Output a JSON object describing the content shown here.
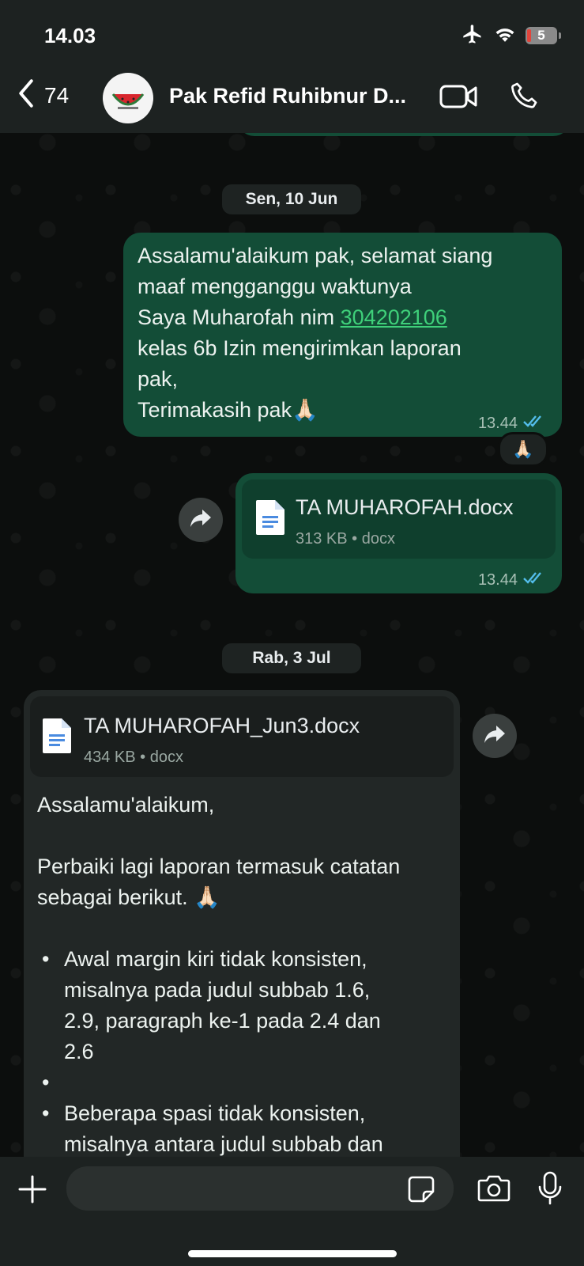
{
  "status_bar": {
    "time": "14.03",
    "battery": "5"
  },
  "header": {
    "back_count": "74",
    "contact_name": "Pak Refid Ruhibnur D..."
  },
  "dates": {
    "first": "Sen, 10 Jun",
    "second": "Rab, 3 Jul"
  },
  "messages": {
    "m1": {
      "line1": "Assalamu'alaikum pak, selamat siang",
      "line2": "maaf mengganggu waktunya",
      "line3_prefix": "Saya Muharofah nim ",
      "line3_link": "304202106",
      "line4": "kelas 6b Izin mengirimkan laporan",
      "line5": "pak,",
      "line6": "Terimakasih pak🙏🏻",
      "time": "13.44",
      "reaction": "🙏🏻"
    },
    "m2": {
      "file_name": "TA MUHAROFAH.docx",
      "file_meta": "313 KB • docx",
      "time": "13.44"
    },
    "m3": {
      "file_name": "TA MUHAROFAH_Jun3.docx",
      "file_meta": "434 KB • docx",
      "greeting": "Assalamu'alaikum,",
      "intro_line1": "Perbaiki lagi laporan termasuk catatan",
      "intro_line2": "sebagai berikut. 🙏🏻",
      "bullet1": [
        "Awal margin kiri tidak konsisten,",
        "misalnya pada judul subbab 1.6,",
        "2.9, paragraph ke-1 pada 2.4 dan",
        "2.6"
      ],
      "bullet2": [
        "Beberapa spasi tidak konsisten,",
        "misalnya antara judul subbab dan"
      ]
    }
  },
  "composer": {
    "placeholder": ""
  },
  "colors": {
    "outgoing_bubble": "#134d37",
    "incoming_bubble": "#222726",
    "link": "#3fd07a",
    "read_ticks": "#53bdeb"
  }
}
